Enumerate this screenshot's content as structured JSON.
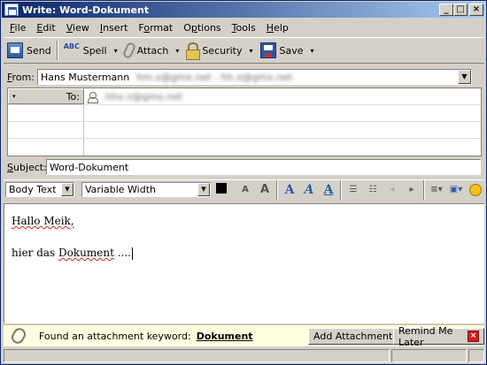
{
  "window": {
    "title": "Write: Word-Dokument",
    "minimize": "_",
    "maximize": "□",
    "close": "×"
  },
  "menu": {
    "items": [
      {
        "u": "F",
        "rest": "ile"
      },
      {
        "u": "E",
        "rest": "dit"
      },
      {
        "u": "V",
        "rest": "iew"
      },
      {
        "u": "I",
        "rest": "nsert"
      },
      {
        "pre": "F",
        "u": "o",
        "rest": "rmat"
      },
      {
        "pre": "O",
        "u": "p",
        "rest": "tions"
      },
      {
        "u": "T",
        "rest": "ools"
      },
      {
        "u": "H",
        "rest": "elp"
      }
    ]
  },
  "toolbar": {
    "send": "Send",
    "spell": "Spell",
    "spell_icon_text": "ABC",
    "attach": "Attach",
    "security": "Security",
    "save": "Save",
    "dropdown": "▾"
  },
  "from": {
    "label_u": "F",
    "label_rest": "rom:",
    "name": "Hans Mustermann",
    "address": "hm.x@gmx.net - hh.x@gmx.net"
  },
  "addressing": {
    "type": "To:",
    "type_arrow": "▾",
    "recipient": "hhx.x@gmx.net"
  },
  "subject": {
    "label_u": "S",
    "label_rest": "ubject:",
    "value": "Word-Dokument"
  },
  "format": {
    "paragraph_style": "Body Text",
    "font": "Variable Width"
  },
  "body": {
    "line1": "Hallo Meik,",
    "line2_a": "hier das ",
    "line2_b": "Dokument",
    "line2_c": " ...."
  },
  "notification": {
    "message": "Found an attachment keyword:",
    "keyword": "Dokument",
    "add_button": "Add Attachment...",
    "remind_button": "Remind Me Later",
    "close": "×"
  }
}
